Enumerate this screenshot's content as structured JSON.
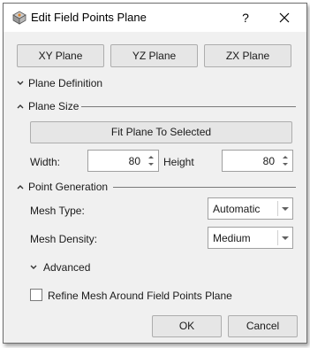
{
  "window": {
    "title": "Edit Field Points Plane",
    "help_label": "?",
    "icons": {
      "app": "plane-tool-icon",
      "close": "close-icon"
    }
  },
  "plane_buttons": [
    "XY Plane",
    "YZ Plane",
    "ZX Plane"
  ],
  "sections": {
    "plane_definition": {
      "label": "Plane Definition",
      "expanded": false
    },
    "plane_size": {
      "label": "Plane Size",
      "expanded": true
    },
    "point_generation": {
      "label": "Point Generation",
      "expanded": true
    },
    "advanced": {
      "label": "Advanced",
      "expanded": false
    }
  },
  "plane_size": {
    "fit_button_label": "Fit Plane To Selected",
    "width_label": "Width:",
    "width_value": "80",
    "height_label": "Height",
    "height_value": "80"
  },
  "point_generation": {
    "mesh_type_label": "Mesh Type:",
    "mesh_type_value": "Automatic",
    "mesh_density_label": "Mesh Density:",
    "mesh_density_value": "Medium"
  },
  "refine_mesh": {
    "label": "Refine Mesh Around Field Points Plane",
    "checked": false
  },
  "footer": {
    "ok_label": "OK",
    "cancel_label": "Cancel"
  }
}
